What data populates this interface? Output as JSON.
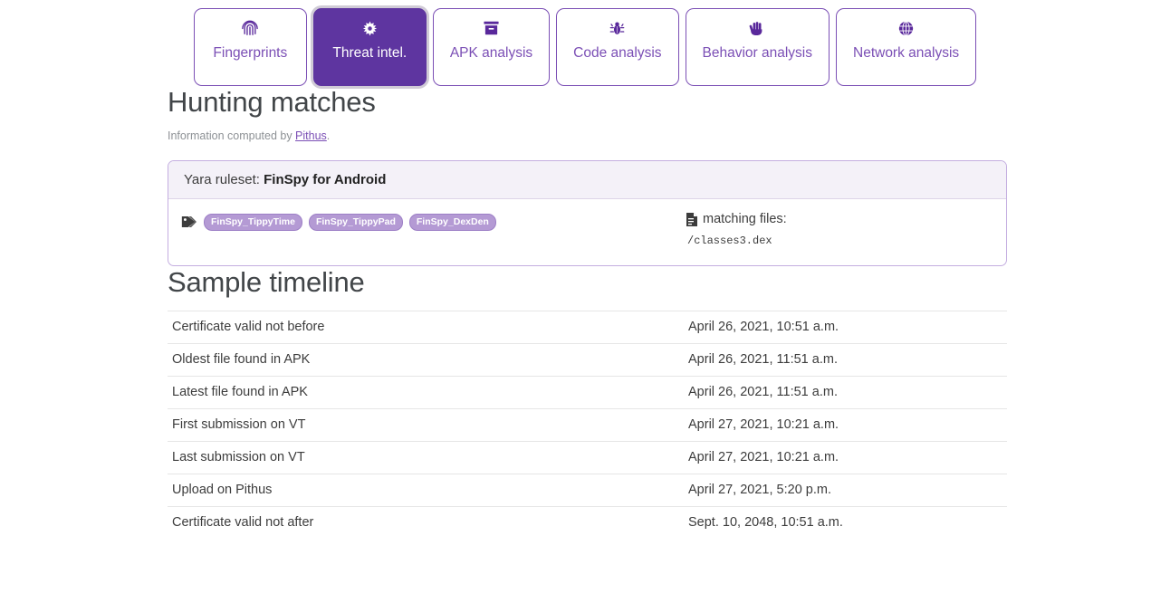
{
  "tabs": [
    {
      "label": "Fingerprints",
      "icon": "fingerprint-icon",
      "active": false
    },
    {
      "label": "Threat intel.",
      "icon": "gear-icon",
      "active": true
    },
    {
      "label": "APK analysis",
      "icon": "archive-box-icon",
      "active": false
    },
    {
      "label": "Code analysis",
      "icon": "bug-icon",
      "active": false
    },
    {
      "label": "Behavior analysis",
      "icon": "hand-icon",
      "active": false
    },
    {
      "label": "Network analysis",
      "icon": "globe-icon",
      "active": false
    }
  ],
  "hunting": {
    "title": "Hunting matches",
    "subtitle_prefix": "Information computed by ",
    "subtitle_link": "Pithus",
    "subtitle_suffix": ".",
    "card": {
      "header_prefix": "Yara ruleset: ",
      "header_name": "FinSpy for Android",
      "tags": [
        "FinSpy_TippyTime",
        "FinSpy_TippyPad",
        "FinSpy_DexDen"
      ],
      "files_label": "matching files:",
      "files": [
        "/classes3.dex"
      ]
    }
  },
  "timeline": {
    "title": "Sample timeline",
    "rows": [
      {
        "label": "Certificate valid not before",
        "value": "April 26, 2021, 10:51 a.m."
      },
      {
        "label": "Oldest file found in APK",
        "value": "April 26, 2021, 11:51 a.m."
      },
      {
        "label": "Latest file found in APK",
        "value": "April 26, 2021, 11:51 a.m."
      },
      {
        "label": "First submission on VT",
        "value": "April 27, 2021, 10:21 a.m."
      },
      {
        "label": "Last submission on VT",
        "value": "April 27, 2021, 10:21 a.m."
      },
      {
        "label": "Upload on Pithus",
        "value": "April 27, 2021, 5:20 p.m."
      },
      {
        "label": "Certificate valid not after",
        "value": "Sept. 10, 2048, 10:51 a.m."
      }
    ]
  },
  "colors": {
    "accent": "#5e35a0",
    "accent_light": "#7b4fb5",
    "tag_bg": "#b49ad4",
    "card_header_bg": "#f4f1f8",
    "card_border": "#c4aee0"
  }
}
